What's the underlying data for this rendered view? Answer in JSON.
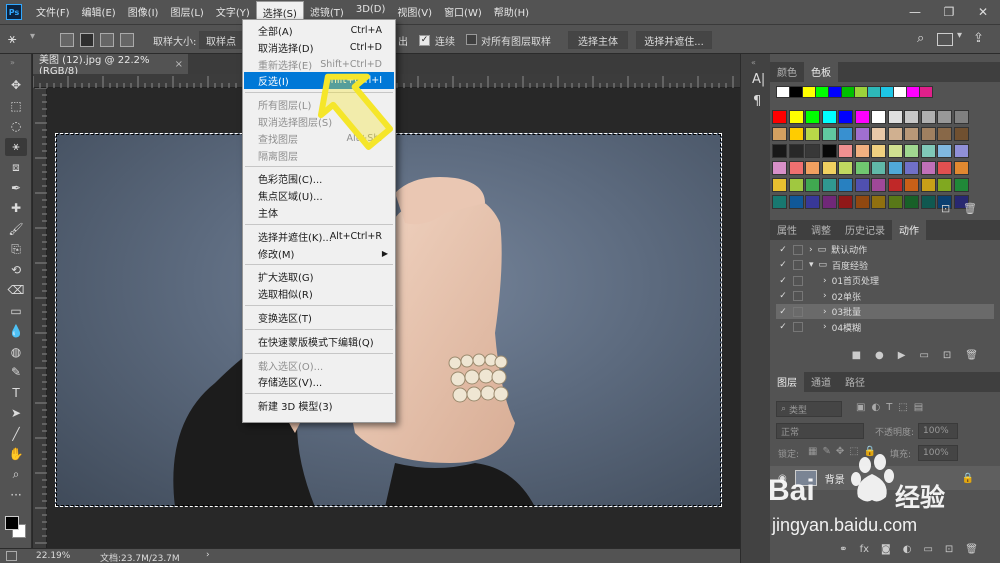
{
  "app": {
    "logo": "Ps",
    "menus": [
      "文件(F)",
      "编辑(E)",
      "图像(I)",
      "图层(L)",
      "文字(Y)",
      "选择(S)",
      "滤镜(T)",
      "3D(D)",
      "视图(V)",
      "窗口(W)",
      "帮助(H)"
    ],
    "active_menu_index": 5,
    "window_controls": [
      "—",
      "❐",
      "✕"
    ]
  },
  "options_bar": {
    "sample_size_label": "取样大小:",
    "sample_size_value": "取样点",
    "tolerance_cut": "出",
    "contiguous_label": "连续",
    "sample_all_label": "对所有图层取样",
    "select_subject": "选择主体",
    "select_and_mask": "选择并遮住..."
  },
  "document": {
    "tab_title": "美图 (12).jpg @ 22.2%(RGB/8)",
    "tab_close": "×"
  },
  "status": {
    "zoom": "22.19%",
    "doc_info": "文档:23.7M/23.7M",
    "arrow": "›"
  },
  "select_menu": {
    "items": [
      {
        "label": "全部(A)",
        "shortcut": "Ctrl+A",
        "disabled": false
      },
      {
        "label": "取消选择(D)",
        "shortcut": "Ctrl+D",
        "disabled": false
      },
      {
        "label": "重新选择(E)",
        "shortcut": "Shift+Ctrl+D",
        "disabled": true
      },
      {
        "label": "反选(I)",
        "shortcut": "Shift+Ctrl+I",
        "disabled": false,
        "highlight": true
      },
      {
        "sep": true
      },
      {
        "label": "所有图层(L)",
        "shortcut": "",
        "disabled": true
      },
      {
        "label": "取消选择图层(S)",
        "shortcut": "",
        "disabled": true
      },
      {
        "label": "查找图层",
        "shortcut": "Alt+Shi",
        "disabled": true
      },
      {
        "label": "隔离图层",
        "shortcut": "",
        "disabled": true
      },
      {
        "sep": true
      },
      {
        "label": "色彩范围(C)...",
        "shortcut": "",
        "disabled": false
      },
      {
        "label": "焦点区域(U)...",
        "shortcut": "",
        "disabled": false
      },
      {
        "label": "主体",
        "shortcut": "",
        "disabled": false
      },
      {
        "sep": true
      },
      {
        "label": "选择并遮住(K)...",
        "shortcut": "Alt+Ctrl+R",
        "disabled": false
      },
      {
        "label": "修改(M)",
        "shortcut": "",
        "disabled": false,
        "submenu": true
      },
      {
        "sep": true
      },
      {
        "label": "扩大选取(G)",
        "shortcut": "",
        "disabled": false
      },
      {
        "label": "选取相似(R)",
        "shortcut": "",
        "disabled": false
      },
      {
        "sep": true
      },
      {
        "label": "变换选区(T)",
        "shortcut": "",
        "disabled": false
      },
      {
        "sep": true
      },
      {
        "label": "在快速蒙版模式下编辑(Q)",
        "shortcut": "",
        "disabled": false
      },
      {
        "sep": true
      },
      {
        "label": "载入选区(O)...",
        "shortcut": "",
        "disabled": true
      },
      {
        "label": "存储选区(V)...",
        "shortcut": "",
        "disabled": false
      },
      {
        "sep": true
      },
      {
        "label": "新建 3D 模型(3)",
        "shortcut": "",
        "disabled": false
      }
    ]
  },
  "panels": {
    "color_tabs": [
      "颜色",
      "色板"
    ],
    "action_tabs": [
      "属性",
      "调整",
      "历史记录",
      "动作"
    ],
    "actions": [
      {
        "label": "默认动作",
        "type": "folder",
        "indent": 0,
        "selected": false
      },
      {
        "label": "百度经验",
        "type": "folder-open",
        "indent": 0,
        "selected": false
      },
      {
        "label": "01首页处理",
        "type": "action",
        "indent": 1,
        "selected": false
      },
      {
        "label": "02单张",
        "type": "action",
        "indent": 1,
        "selected": false
      },
      {
        "label": "03批量",
        "type": "action",
        "indent": 1,
        "selected": true
      },
      {
        "label": "04模糊",
        "type": "action",
        "indent": 1,
        "selected": false
      }
    ],
    "layer_tabs": [
      "图层",
      "通道",
      "路径"
    ],
    "layer_filter": "类型",
    "blend_mode": "正常",
    "opacity_label": "不透明度:",
    "opacity_value": "100%",
    "lock_label": "锁定:",
    "fill_label": "填充:",
    "fill_value": "100%",
    "layer_name": "背景",
    "strip_icons": [
      "A|",
      "¶"
    ]
  },
  "swatch_colors": {
    "top_row": [
      "#ffffff",
      "#000000",
      "#ffff00",
      "#00ff00",
      "#0000ff",
      "#00c000",
      "#9bd33b",
      "#2db8b8",
      "#1ec6e6",
      "#ffffff",
      "#ff00ff",
      "#e0208a"
    ],
    "grid": [
      [
        "#ff0000",
        "#ffff00",
        "#00ff00",
        "#00ffff",
        "#0000ff",
        "#ff00ff",
        "#ffffff",
        "#e0e0e0",
        "#c8c8c8",
        "#b0b0b0",
        "#989898",
        "#808080"
      ],
      [
        "#d4a060",
        "#ffcc00",
        "#b8d848",
        "#60c8a0",
        "#3890d0",
        "#a06fd0",
        "#e8c8a8",
        "#d0b090",
        "#b89878",
        "#a08060",
        "#886848",
        "#705030"
      ],
      [
        "#181818",
        "#282828",
        "#383838",
        "#080808",
        "#f09090",
        "#f0b080",
        "#f0d080",
        "#d0e090",
        "#a0d890",
        "#80c8b8",
        "#80b8e0",
        "#9090d8"
      ],
      [
        "#d890c8",
        "#f07070",
        "#f0a060",
        "#f0d060",
        "#c0d860",
        "#70c870",
        "#60b8a8",
        "#50a8d8",
        "#7070c8",
        "#c070b8",
        "#e05050",
        "#e08830"
      ],
      [
        "#e8c030",
        "#a0c840",
        "#40a850",
        "#309890",
        "#2880c0",
        "#5050b0",
        "#a04898",
        "#c02828",
        "#c86018",
        "#c8a018",
        "#80a820",
        "#208838"
      ],
      [
        "#187870",
        "#105898",
        "#383898",
        "#702878",
        "#901818",
        "#904810",
        "#907010",
        "#587818",
        "#186028",
        "#105850",
        "#0c4070",
        "#282870"
      ]
    ],
    "accent_arrow": "#f5e62a",
    "menu_highlight": "#0078d7"
  },
  "watermark": {
    "logo_text": "Bai",
    "logo_text2": "经验",
    "url": "jingyan.baidu.com"
  }
}
